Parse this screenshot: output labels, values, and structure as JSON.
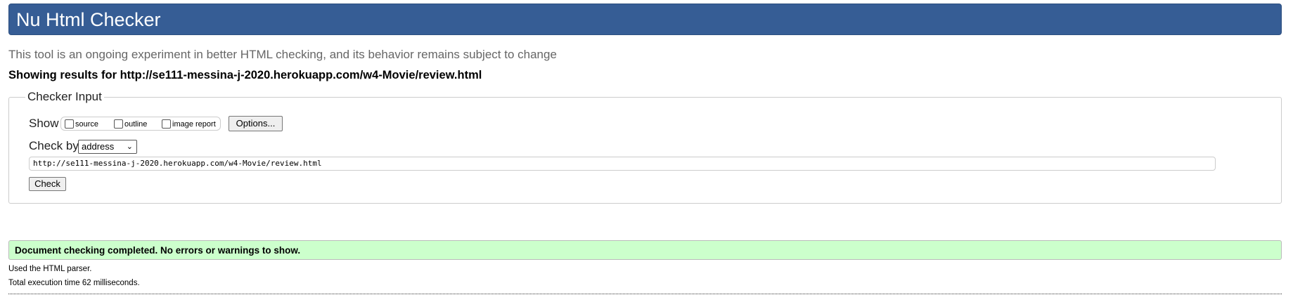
{
  "header": {
    "title": "Nu Html Checker"
  },
  "intro": "This tool is an ongoing experiment in better HTML checking, and its behavior remains subject to change",
  "showing_results": "Showing results for http://se111-messina-j-2020.herokuapp.com/w4-Movie/review.html",
  "checker_input": {
    "legend": "Checker Input",
    "show_label": "Show",
    "show_options": [
      {
        "label": "source",
        "checked": false
      },
      {
        "label": "outline",
        "checked": false
      },
      {
        "label": "image report",
        "checked": false
      }
    ],
    "options_button": "Options...",
    "check_by_label": "Check by",
    "check_by_value": "address",
    "url_value": "http://se111-messina-j-2020.herokuapp.com/w4-Movie/review.html",
    "check_button": "Check"
  },
  "result": {
    "message": "Document checking completed. No errors or warnings to show.",
    "parser": "Used the HTML parser.",
    "execution_time": "Total execution time 62 milliseconds."
  },
  "colors": {
    "header_bg": "#365d95",
    "success_bg": "#ccffcc"
  }
}
